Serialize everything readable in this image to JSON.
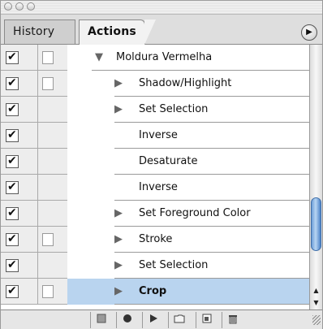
{
  "window": {
    "controls": [
      "close-button",
      "minimize-button",
      "zoom-button"
    ]
  },
  "tabs": [
    {
      "label": "History",
      "active": false
    },
    {
      "label": "Actions",
      "active": true
    }
  ],
  "palette_menu_icon": "triangle-right-icon",
  "rows": [
    {
      "checked": true,
      "dialog": true,
      "expanded": true,
      "level": 0,
      "label": "Moldura Vermelha",
      "selected": false
    },
    {
      "checked": true,
      "dialog": true,
      "expanded": false,
      "level": 1,
      "has_children": true,
      "label": "Shadow/Highlight",
      "selected": false
    },
    {
      "checked": true,
      "dialog": false,
      "expanded": false,
      "level": 1,
      "has_children": true,
      "label": "Set Selection",
      "selected": false
    },
    {
      "checked": true,
      "dialog": false,
      "expanded": false,
      "level": 1,
      "has_children": false,
      "label": "Inverse",
      "selected": false
    },
    {
      "checked": true,
      "dialog": false,
      "expanded": false,
      "level": 1,
      "has_children": false,
      "label": "Desaturate",
      "selected": false
    },
    {
      "checked": true,
      "dialog": false,
      "expanded": false,
      "level": 1,
      "has_children": false,
      "label": "Inverse",
      "selected": false
    },
    {
      "checked": true,
      "dialog": false,
      "expanded": false,
      "level": 1,
      "has_children": true,
      "label": "Set Foreground Color",
      "selected": false
    },
    {
      "checked": true,
      "dialog": true,
      "expanded": false,
      "level": 1,
      "has_children": true,
      "label": "Stroke",
      "selected": false
    },
    {
      "checked": true,
      "dialog": false,
      "expanded": false,
      "level": 1,
      "has_children": true,
      "label": "Set Selection",
      "selected": false
    },
    {
      "checked": true,
      "dialog": true,
      "expanded": false,
      "level": 1,
      "has_children": true,
      "label": "Crop",
      "selected": true
    }
  ],
  "toolbar": [
    {
      "icon": "stop-icon"
    },
    {
      "icon": "record-icon"
    },
    {
      "icon": "play-icon"
    },
    {
      "icon": "new-set-folder-icon"
    },
    {
      "icon": "new-action-icon"
    },
    {
      "icon": "trash-icon"
    }
  ],
  "colors": {
    "selection": "#b9d4ef",
    "scroll_thumb": "#6d9ed8"
  }
}
